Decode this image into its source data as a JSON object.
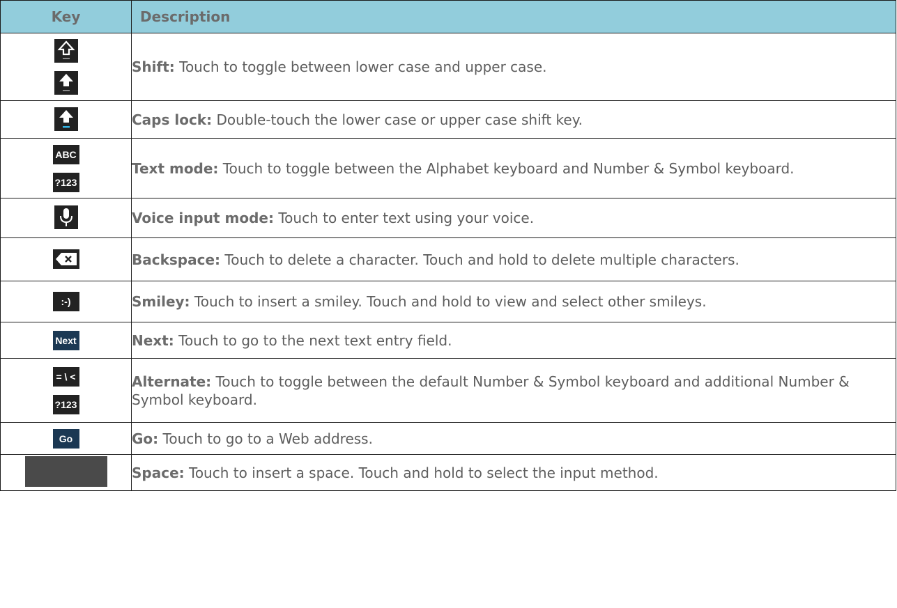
{
  "table": {
    "headers": {
      "key": "Key",
      "description": "Description"
    },
    "rows": [
      {
        "icons": [
          "shift-lower-icon",
          "shift-upper-icon"
        ],
        "term": "Shift:",
        "text": " Touch to toggle between lower case and upper case."
      },
      {
        "icons": [
          "caps-lock-icon"
        ],
        "term": "Caps lock:",
        "text": " Double-touch the lower case or upper case shift key."
      },
      {
        "icons": [
          "abc-key-icon",
          "number-key-icon"
        ],
        "icon_labels": [
          "ABC",
          "?123"
        ],
        "term": "Text mode:",
        "text": " Touch to toggle between the Alphabet keyboard and Number & Symbol keyboard."
      },
      {
        "icons": [
          "microphone-icon"
        ],
        "term": "Voice input mode:",
        "text": " Touch to enter text using your voice."
      },
      {
        "icons": [
          "backspace-icon"
        ],
        "term": "Backspace:",
        "text": " Touch to delete a character. Touch and hold to delete multiple characters."
      },
      {
        "icons": [
          "smiley-key-icon"
        ],
        "icon_labels": [
          ":-)"
        ],
        "term": "Smiley:",
        "text": " Touch to insert a smiley. Touch and hold to view and select other smileys."
      },
      {
        "icons": [
          "next-key-icon"
        ],
        "icon_labels": [
          "Next"
        ],
        "term": "Next:",
        "text": " Touch to go to the next text entry field."
      },
      {
        "icons": [
          "alternate-key-icon",
          "number-key-icon"
        ],
        "icon_labels": [
          "= \\ <",
          "?123"
        ],
        "term": "Alternate:",
        "text": " Touch to toggle between the default Number & Symbol keyboard and additional Number & Symbol keyboard."
      },
      {
        "icons": [
          "go-key-icon"
        ],
        "icon_labels": [
          "Go"
        ],
        "term": "Go:",
        "text": " Touch to go to a Web address."
      },
      {
        "icons": [
          "space-key-icon"
        ],
        "term": "Space:",
        "text": " Touch to insert a space. Touch and hold to select the input method."
      }
    ]
  },
  "colors": {
    "header_bg": "#92cddc",
    "text": "#5d5d5d",
    "key_bg": "#222222",
    "navy_key_bg": "#1b3853",
    "cursor_blue": "#33b5e5"
  }
}
